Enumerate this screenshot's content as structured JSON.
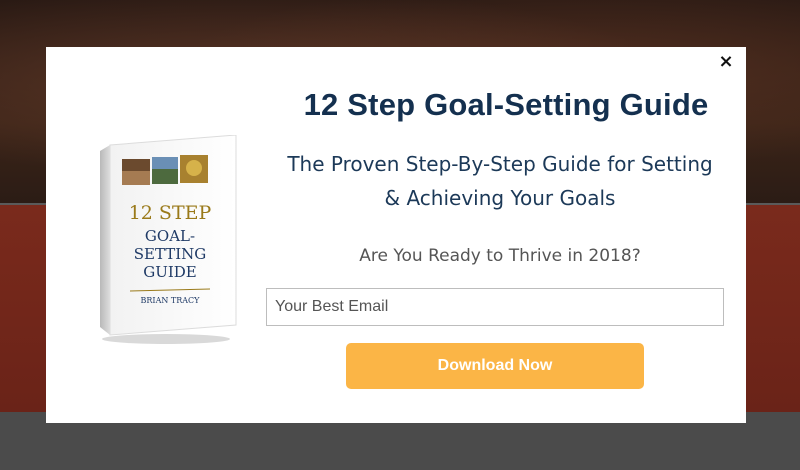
{
  "modal": {
    "close_label": "×",
    "headline": "12 Step Goal-Setting Guide",
    "subheadline_line1": "The Proven Step-By-Step Guide for Setting",
    "subheadline_line2": "& Achieving Your Goals",
    "prompt": "Are You Ready to Thrive in 2018?",
    "email_placeholder": "Your Best Email",
    "email_value": "",
    "download_label": "Download Now"
  },
  "book": {
    "title_line1": "12 STEP",
    "title_line2": "GOAL-",
    "title_line3": "SETTING",
    "title_line4": "GUIDE",
    "author": "BRIAN TRACY"
  },
  "colors": {
    "headline": "#14304f",
    "button": "#fbb546",
    "book_title": "#9a7a1a",
    "book_subtitle": "#1f3a66"
  }
}
